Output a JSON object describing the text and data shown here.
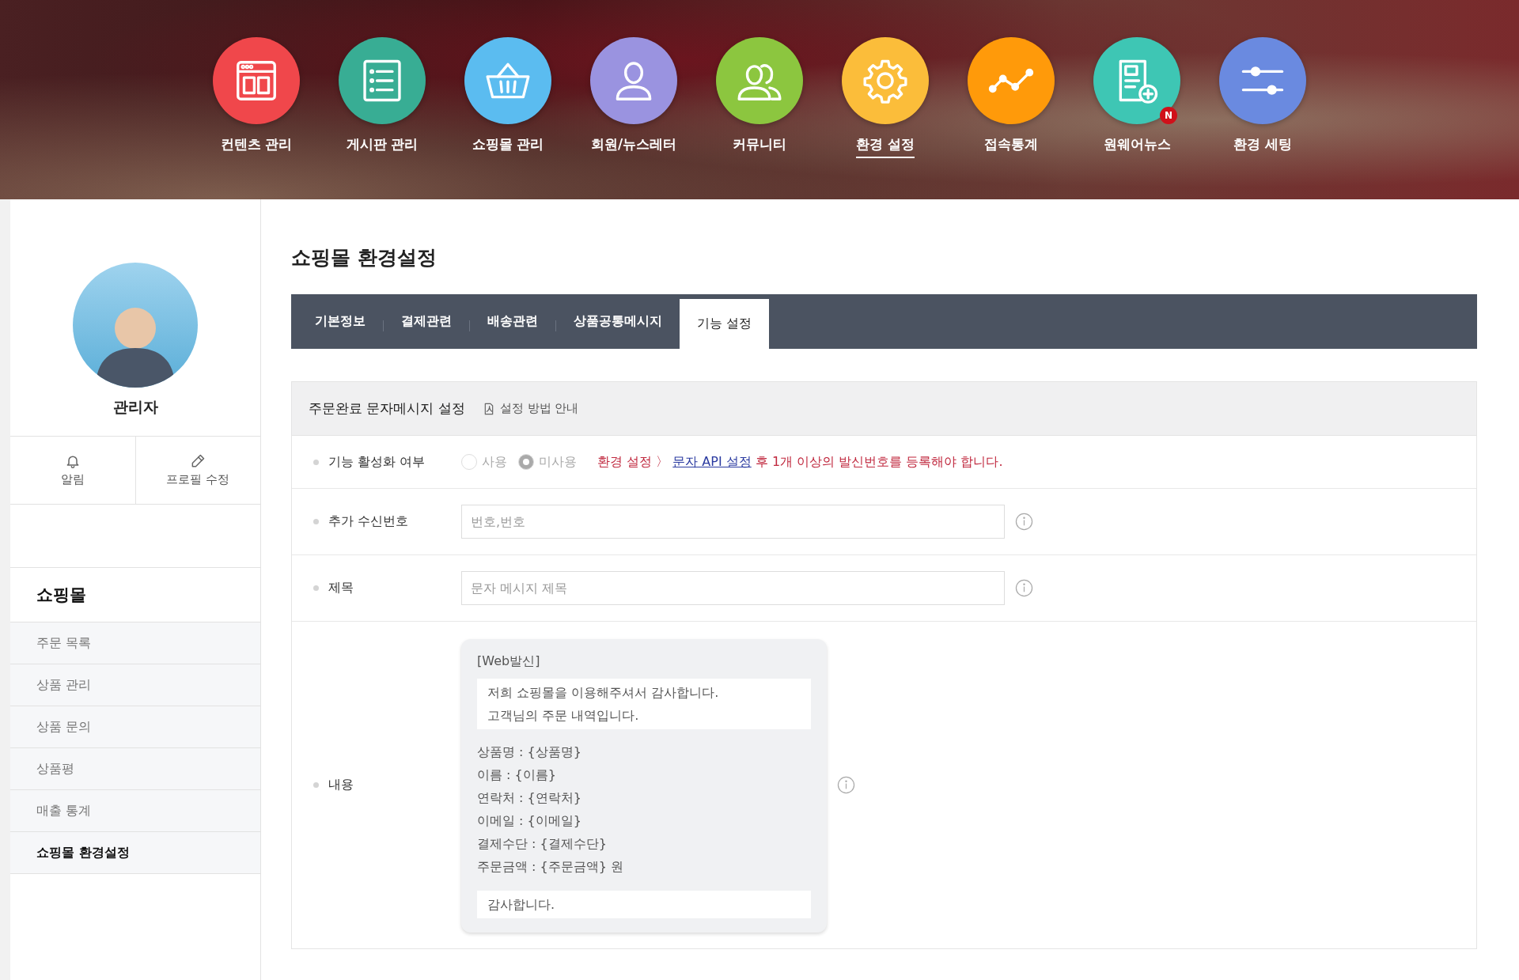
{
  "top_nav": [
    {
      "label": "컨텐츠 관리",
      "color": "#f0474b",
      "selected": false
    },
    {
      "label": "게시판 관리",
      "color": "#38ad94",
      "selected": false
    },
    {
      "label": "쇼핑몰 관리",
      "color": "#5bbcf0",
      "selected": false
    },
    {
      "label": "회원/뉴스레터",
      "color": "#9a93e0",
      "selected": false
    },
    {
      "label": "커뮤니티",
      "color": "#8cc63f",
      "selected": false
    },
    {
      "label": "환경 설정",
      "color": "#fbbd3a",
      "selected": true
    },
    {
      "label": "접속통계",
      "color": "#ff9a0a",
      "selected": false
    },
    {
      "label": "원웨어뉴스",
      "color": "#3ec6b4",
      "selected": false,
      "badge": "N"
    },
    {
      "label": "환경 세팅",
      "color": "#6a8ae0",
      "selected": false
    }
  ],
  "profile": {
    "name": "관리자",
    "actions": [
      "알림",
      "프로필 수정"
    ]
  },
  "sidebar": {
    "heading": "쇼핑몰",
    "items": [
      {
        "label": "주문 목록",
        "selected": false
      },
      {
        "label": "상품 관리",
        "selected": false
      },
      {
        "label": "상품 문의",
        "selected": false
      },
      {
        "label": "상품평",
        "selected": false
      },
      {
        "label": "매출 통계",
        "selected": false
      },
      {
        "label": "쇼핑몰 환경설정",
        "selected": true
      }
    ]
  },
  "page_title": "쇼핑몰 환경설정",
  "tabs": [
    {
      "label": "기본정보",
      "selected": false
    },
    {
      "label": "결제관련",
      "selected": false
    },
    {
      "label": "배송관련",
      "selected": false
    },
    {
      "label": "상품공통메시지",
      "selected": false
    },
    {
      "label": "기능 설정",
      "selected": true
    }
  ],
  "section": {
    "title": "주문완료 문자메시지 설정",
    "guide_link": "설정 방법 안내"
  },
  "rows": [
    {
      "kind": "radio",
      "label": "기능 활성화 여부",
      "options": [
        {
          "label": "사용",
          "selected": false
        },
        {
          "label": "미사용",
          "selected": true
        }
      ],
      "disabled": true,
      "notice": {
        "before": "환경 설정 〉 ",
        "link": "문자 API 설정",
        "after": " 후 1개 이상의 발신번호를 등록해야 합니다."
      }
    },
    {
      "kind": "input",
      "label": "추가 수신번호",
      "placeholder": "번호,번호"
    },
    {
      "kind": "input",
      "label": "제목",
      "placeholder": "문자 메시지 제목"
    },
    {
      "kind": "message",
      "label": "내용",
      "message": {
        "header": "[Web발신]",
        "intro": [
          "저희 쇼핑몰을 이용해주셔서 감사합니다.",
          "고객님의 주문 내역입니다."
        ],
        "fields": [
          "상품명 : {상품명}",
          "이름 : {이름}",
          "연락처 : {연락처}",
          "이메일 : {이메일}",
          "결제수단 : {결제수단}",
          "주문금액 : {주문금액} 원"
        ],
        "closing": "감사합니다."
      }
    }
  ]
}
